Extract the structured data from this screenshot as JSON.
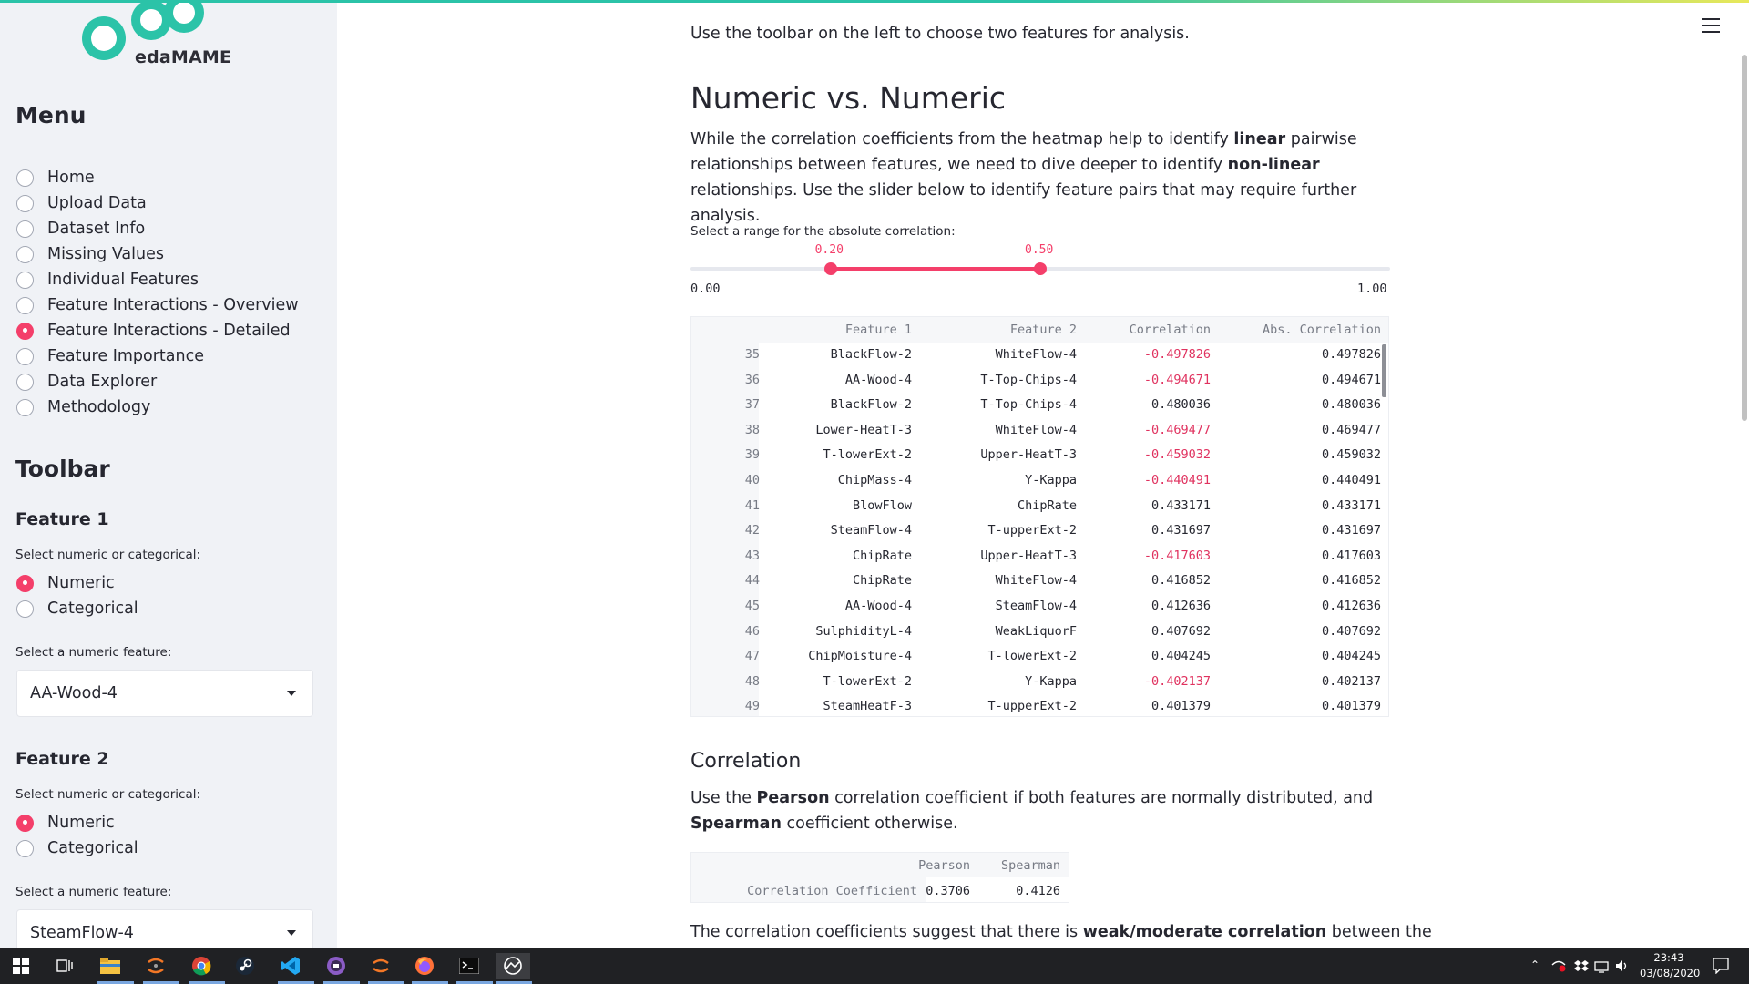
{
  "app": {
    "logo_text": "edaMAME"
  },
  "sidebar": {
    "menu_title": "Menu",
    "menu_items": [
      {
        "label": "Home",
        "selected": false
      },
      {
        "label": "Upload Data",
        "selected": false
      },
      {
        "label": "Dataset Info",
        "selected": false
      },
      {
        "label": "Missing Values",
        "selected": false
      },
      {
        "label": "Individual Features",
        "selected": false
      },
      {
        "label": "Feature Interactions - Overview",
        "selected": false
      },
      {
        "label": "Feature Interactions - Detailed",
        "selected": true
      },
      {
        "label": "Feature Importance",
        "selected": false
      },
      {
        "label": "Data Explorer",
        "selected": false
      },
      {
        "label": "Methodology",
        "selected": false
      }
    ],
    "toolbar_title": "Toolbar",
    "feature1": {
      "title": "Feature 1",
      "type_label": "Select numeric or categorical:",
      "options": [
        {
          "label": "Numeric",
          "selected": true
        },
        {
          "label": "Categorical",
          "selected": false
        }
      ],
      "select_label": "Select a numeric feature:",
      "selected_value": "AA-Wood-4"
    },
    "feature2": {
      "title": "Feature 2",
      "type_label": "Select numeric or categorical:",
      "options": [
        {
          "label": "Numeric",
          "selected": true
        },
        {
          "label": "Categorical",
          "selected": false
        }
      ],
      "select_label": "Select a numeric feature:",
      "selected_value": "SteamFlow-4"
    }
  },
  "main": {
    "intro": "Use the toolbar on the left to choose two features for analysis.",
    "heading": "Numeric vs. Numeric",
    "para1": {
      "t1": "While the correlation coefficients from the heatmap help to identify ",
      "b1": "linear",
      "t2": " pairwise relationships between features, we need to dive deeper to identify ",
      "b2": "non-linear",
      "t3": " relationships. Use the slider below to identify feature pairs that may require further analysis."
    },
    "slider": {
      "label": "Select a range for the absolute correlation:",
      "min_label": "0.00",
      "max_label": "1.00",
      "low_label": "0.20",
      "high_label": "0.50",
      "min": 0.0,
      "max": 1.0,
      "low": 0.2,
      "high": 0.5
    },
    "table": {
      "headers": [
        "Feature 1",
        "Feature 2",
        "Correlation",
        "Abs. Correlation"
      ],
      "rows": [
        {
          "idx": "35",
          "f1": "BlackFlow-2",
          "f2": "WhiteFlow-4",
          "corr": "-0.497826",
          "abs": "0.497826"
        },
        {
          "idx": "36",
          "f1": "AA-Wood-4",
          "f2": "T-Top-Chips-4",
          "corr": "-0.494671",
          "abs": "0.494671"
        },
        {
          "idx": "37",
          "f1": "BlackFlow-2",
          "f2": "T-Top-Chips-4",
          "corr": "0.480036",
          "abs": "0.480036"
        },
        {
          "idx": "38",
          "f1": "Lower-HeatT-3",
          "f2": "WhiteFlow-4",
          "corr": "-0.469477",
          "abs": "0.469477"
        },
        {
          "idx": "39",
          "f1": "T-lowerExt-2",
          "f2": "Upper-HeatT-3",
          "corr": "-0.459032",
          "abs": "0.459032"
        },
        {
          "idx": "40",
          "f1": "ChipMass-4",
          "f2": "Y-Kappa",
          "corr": "-0.440491",
          "abs": "0.440491"
        },
        {
          "idx": "41",
          "f1": "BlowFlow",
          "f2": "ChipRate",
          "corr": "0.433171",
          "abs": "0.433171"
        },
        {
          "idx": "42",
          "f1": "SteamFlow-4",
          "f2": "T-upperExt-2",
          "corr": "0.431697",
          "abs": "0.431697"
        },
        {
          "idx": "43",
          "f1": "ChipRate",
          "f2": "Upper-HeatT-3",
          "corr": "-0.417603",
          "abs": "0.417603"
        },
        {
          "idx": "44",
          "f1": "ChipRate",
          "f2": "WhiteFlow-4",
          "corr": "0.416852",
          "abs": "0.416852"
        },
        {
          "idx": "45",
          "f1": "AA-Wood-4",
          "f2": "SteamFlow-4",
          "corr": "0.412636",
          "abs": "0.412636"
        },
        {
          "idx": "46",
          "f1": "SulphidityL-4",
          "f2": "WeakLiquorF",
          "corr": "0.407692",
          "abs": "0.407692"
        },
        {
          "idx": "47",
          "f1": "ChipMoisture-4",
          "f2": "T-lowerExt-2",
          "corr": "0.404245",
          "abs": "0.404245"
        },
        {
          "idx": "48",
          "f1": "T-lowerExt-2",
          "f2": "Y-Kappa",
          "corr": "-0.402137",
          "abs": "0.402137"
        },
        {
          "idx": "49",
          "f1": "SteamHeatF-3",
          "f2": "T-upperExt-2",
          "corr": "0.401379",
          "abs": "0.401379"
        }
      ]
    },
    "correlation_section": {
      "heading": "Correlation",
      "para": {
        "t1": "Use the ",
        "b1": "Pearson",
        "t2": " correlation coefficient if both features are normally distributed, and ",
        "b2": "Spearman",
        "t3": " coefficient otherwise."
      },
      "table": {
        "col1": "Pearson",
        "col2": "Spearman",
        "row_label": "Correlation Coefficient",
        "pearson": "0.3706",
        "spearman": "0.4126"
      },
      "conclusion": {
        "t1": "The correlation coefficients suggest that there is ",
        "b1": "weak/moderate correlation",
        "t2": " between the"
      }
    }
  },
  "taskbar": {
    "time": "23:43",
    "date": "03/08/2020"
  },
  "colors": {
    "accent": "#f43f6a",
    "negative": "#e0325f",
    "sidebar_bg": "#f0f2f6",
    "taskbar_bg": "#202124"
  }
}
